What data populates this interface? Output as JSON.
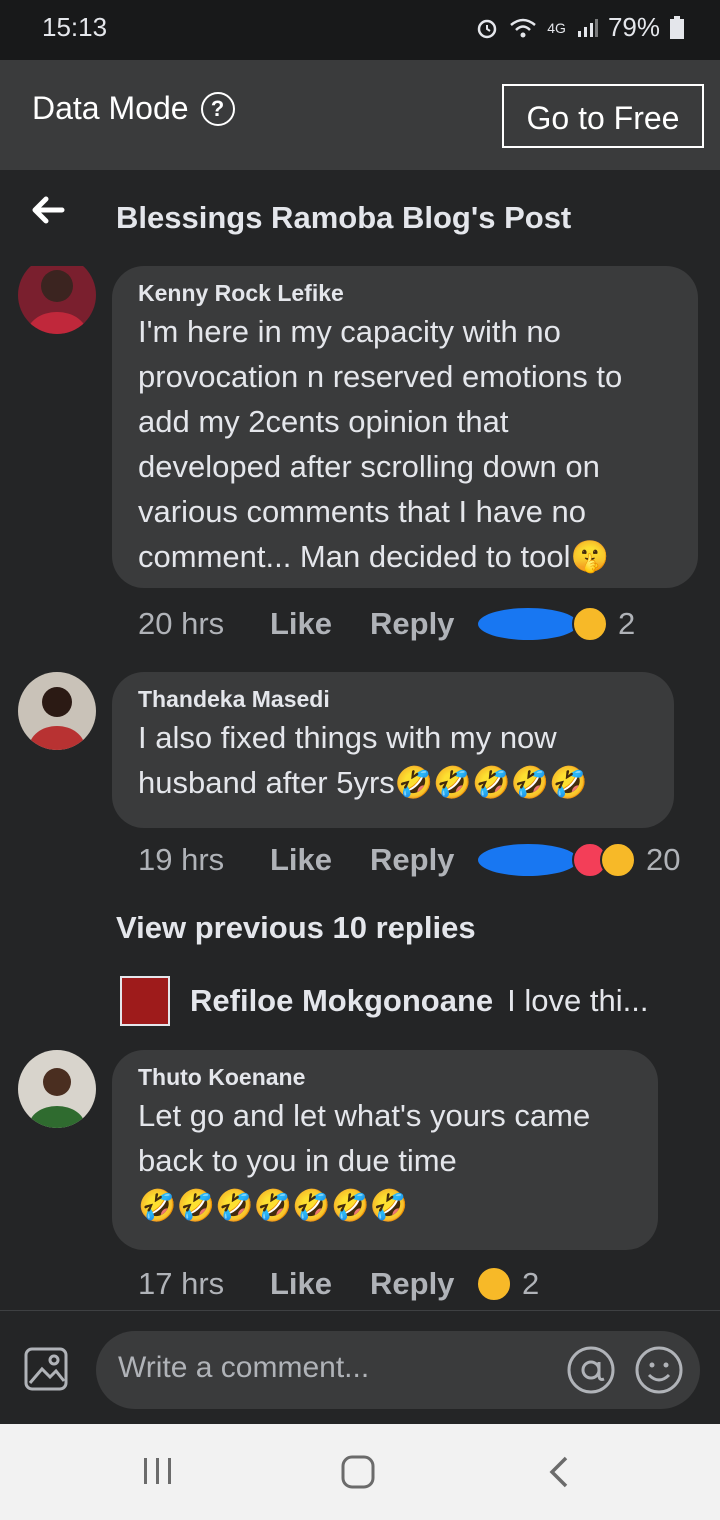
{
  "status_bar": {
    "time": "15:13",
    "battery": "79%",
    "network": "4G"
  },
  "data_mode": {
    "label": "Data Mode",
    "button": "Go to Free"
  },
  "header": {
    "title": "Blessings Ramoba Blog's Post"
  },
  "comments": [
    {
      "name": "Kenny Rock Lefike",
      "text_lines": [
        "I'm here in my capacity with no",
        "provocation n reserved emotions to",
        "add my 2cents opinion that",
        "developed after scrolling down on",
        "various comments that I have no",
        "comment... Man decided to tool🤫"
      ],
      "time": "20 hrs",
      "like": "Like",
      "reply": "Reply",
      "reaction_count": "2",
      "reactions": [
        "like-icon",
        "haha-icon"
      ]
    },
    {
      "name": "Thandeka Masedi",
      "text_lines": [
        "I also fixed things with my now",
        "husband after 5yrs🤣🤣🤣🤣🤣"
      ],
      "time": "19 hrs",
      "like": "Like",
      "reply": "Reply",
      "reaction_count": "20",
      "reactions": [
        "like-icon",
        "love-icon",
        "haha-icon"
      ]
    },
    {
      "name": "Thuto Koenane",
      "text_lines": [
        "Let go and let what's yours came",
        "back to you in due time",
        "🤣🤣🤣🤣🤣🤣🤣"
      ],
      "time": "17 hrs",
      "like": "Like",
      "reply": "Reply",
      "reaction_count": "2",
      "reactions": [
        "haha-icon"
      ]
    }
  ],
  "view_previous": "View previous 10 replies",
  "reply_preview": {
    "name": "Refiloe Mokgonoane",
    "text": "I love thi..."
  },
  "comment_input": {
    "placeholder": "Write a comment..."
  },
  "colors": {
    "bg": "#242526",
    "bubble": "#3a3b3c",
    "like_blue": "#1877f2",
    "love_red": "#f33e58",
    "haha_yellow": "#f7b928"
  }
}
